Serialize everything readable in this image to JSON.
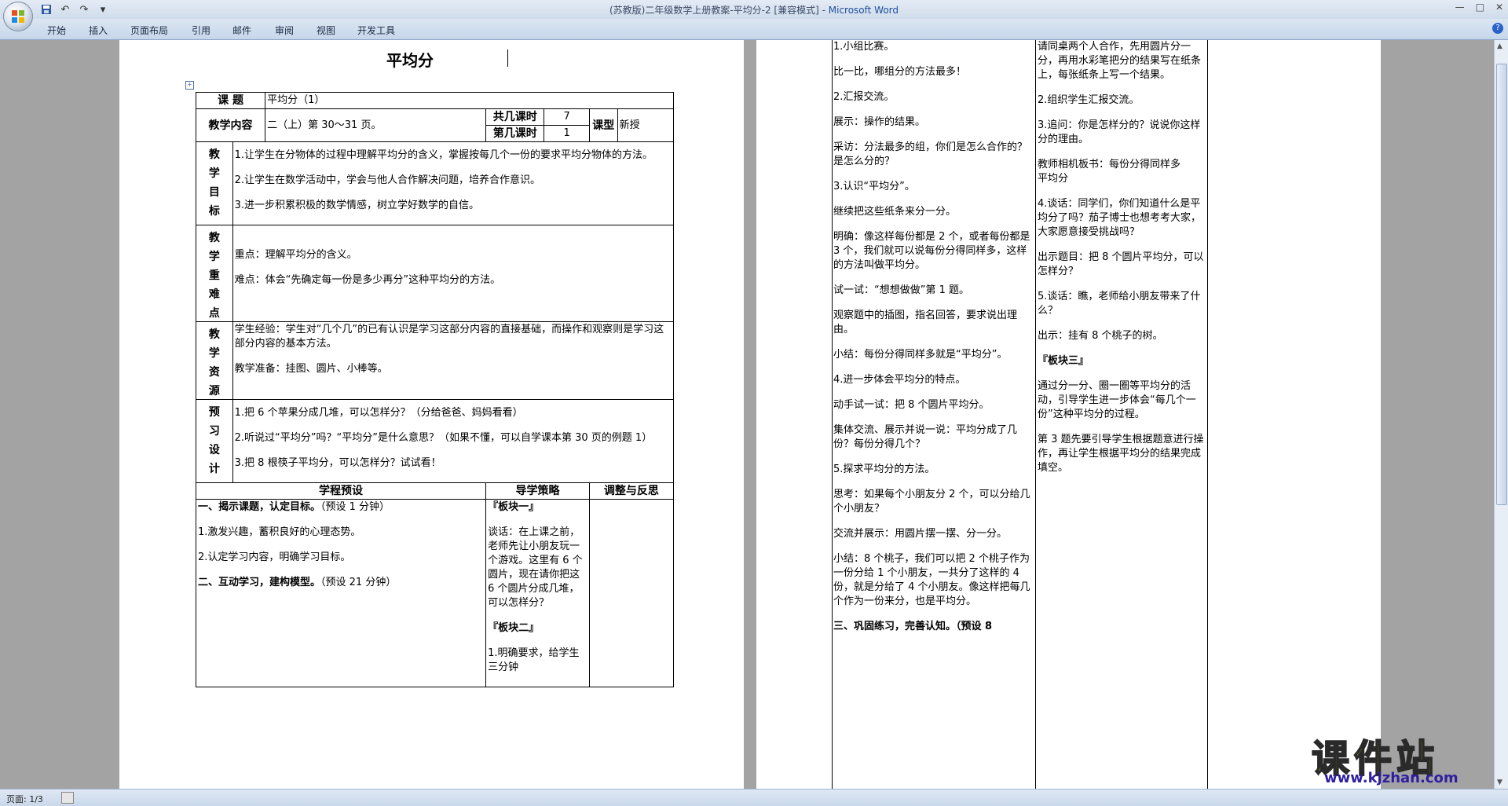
{
  "window": {
    "title": "(苏教版)二年级数学上册教案-平均分-2 [兼容模式] - ",
    "app": "Microsoft Word",
    "controls": [
      "—",
      "□",
      "✕"
    ]
  },
  "quick_access": [
    "save-icon",
    "undo-icon",
    "redo-icon",
    "customize-icon"
  ],
  "ribbon": {
    "tabs": [
      "开始",
      "插入",
      "页面布局",
      "引用",
      "邮件",
      "审阅",
      "视图",
      "开发工具"
    ],
    "help": "?"
  },
  "status": {
    "page": "页面: 1/3"
  },
  "watermark": {
    "main": "课件站",
    "url": "www.kjzhan.com"
  },
  "page1": {
    "title": "平均分",
    "rows": {
      "topic_label": "课 题",
      "topic_value": "平均分（1）",
      "content_label": "教学内容",
      "content_value": "二（上）第 30～31 页。",
      "total_label": "共几课时",
      "total_value": "7",
      "nth_label": "第几课时",
      "nth_value": "1",
      "type_label": "课型",
      "type_value": "新授",
      "goals_label": [
        "教",
        "学",
        "目",
        "标"
      ],
      "goals": [
        "1.让学生在分物体的过程中理解平均分的含义，掌握按每几个一份的要求平均分物体的方法。",
        "2.让学生在数学活动中，学会与他人合作解决问题，培养合作意识。",
        "3.进一步积累积极的数学情感，树立学好数学的自信。"
      ],
      "keys_label": [
        "教",
        "学",
        "重",
        "难",
        "点"
      ],
      "keys": [
        "重点：理解平均分的含义。",
        "难点：体会“先确定每一份是多少再分”这种平均分的方法。"
      ],
      "resources_label": [
        "教",
        "学",
        "资",
        "源"
      ],
      "resources": [
        "学生经验：学生对“几个几”的已有认识是学习这部分内容的直接基础，而操作和观察则是学习这部分内容的基本方法。",
        "教学准备：挂图、圆片、小棒等。"
      ],
      "preview_label": [
        "预",
        "习",
        "设",
        "计"
      ],
      "preview": [
        "1.把 6 个苹果分成几堆，可以怎样分？（分给爸爸、妈妈看看）",
        "2.听说过“平均分”吗？“平均分”是什么意思？（如果不懂，可以自学课本第 30 页的例题 1）",
        "3.把 8 根筷子平均分，可以怎样分？试试看！"
      ],
      "header_cols": [
        "学程预设",
        "导学策略",
        "调整与反思"
      ],
      "process_left": [
        {
          "bold": "一、揭示课题，认定目标。",
          "rest": "（预设 1 分钟）"
        },
        {
          "bold": "",
          "rest": "1.激发兴趣，蓄积良好的心理态势。"
        },
        {
          "bold": "",
          "rest": "2.认定学习内容，明确学习目标。"
        },
        {
          "bold": "二、互动学习，建构模型。",
          "rest": "（预设 21 分钟）"
        }
      ],
      "process_mid": [
        {
          "bold": "『板块一』",
          "rest": ""
        },
        {
          "bold": "",
          "rest": "谈话：在上课之前，老师先让小朋友玩一个游戏。这里有 6 个圆片，现在请你把这 6 个圆片分成几堆，可以怎样分？"
        },
        {
          "bold": "『板块二』",
          "rest": ""
        },
        {
          "bold": "",
          "rest": "1.明确要求，给学生三分钟"
        }
      ]
    }
  },
  "page2": {
    "col_a": [
      "1.小组比赛。",
      "比一比，哪组分的方法最多！",
      "2.汇报交流。",
      "展示：操作的结果。",
      "采访：分法最多的组，你们是怎么合作的？是怎么分的？",
      "3.认识“平均分”。",
      "继续把这些纸条来分一分。",
      "明确：像这样每份都是 2 个，或者每份都是 3 个，我们就可以说每份分得同样多，这样的方法叫做平均分。",
      "试一试：“想想做做”第 1 题。",
      "观察题中的插图，指名回答，要求说出理由。",
      "小结：每份分得同样多就是“平均分”。",
      "4.进一步体会平均分的特点。",
      "动手试一试：把 8 个圆片平均分。",
      "集体交流、展示并说一说：平均分成了几份？每份分得几个？",
      "5.探求平均分的方法。",
      "思考：如果每个小朋友分 2 个，可以分给几个小朋友？",
      "交流并展示：用圆片摆一摆、分一分。",
      "小结：8 个桃子，我们可以把 2 个桃子作为一份分给 1 个小朋友，一共分了这样的 4 份，就是分给了 4 个小朋友。像这样把每几个作为一份来分，也是平均分。",
      "三、巩固练习，完善认知。（预设 8"
    ],
    "col_b": [
      "请同桌两个人合作，先用圆片分一分，再用水彩笔把分的结果写在纸条上，每张纸条上写一个结果。",
      "2.组织学生汇报交流。",
      "3.追问：你是怎样分的？说说你这样分的理由。",
      "教师相机板书：每份分得同样多　　平均分",
      "4.谈话：同学们，你们知道什么是平均分了吗？茄子博士也想考考大家，大家愿意接受挑战吗？",
      "出示题目：把 8 个圆片平均分，可以怎样分？",
      "5.谈话：瞧，老师给小朋友带来了什么？",
      "出示：挂有 8 个桃子的树。",
      "『板块三』",
      "通过分一分、圈一圈等平均分的活动，引导学生进一步体会“每几个一份”这种平均分的过程。",
      "第 3 题先要引导学生根据题意进行操作，再让学生根据平均分的结果完成填空。"
    ]
  }
}
